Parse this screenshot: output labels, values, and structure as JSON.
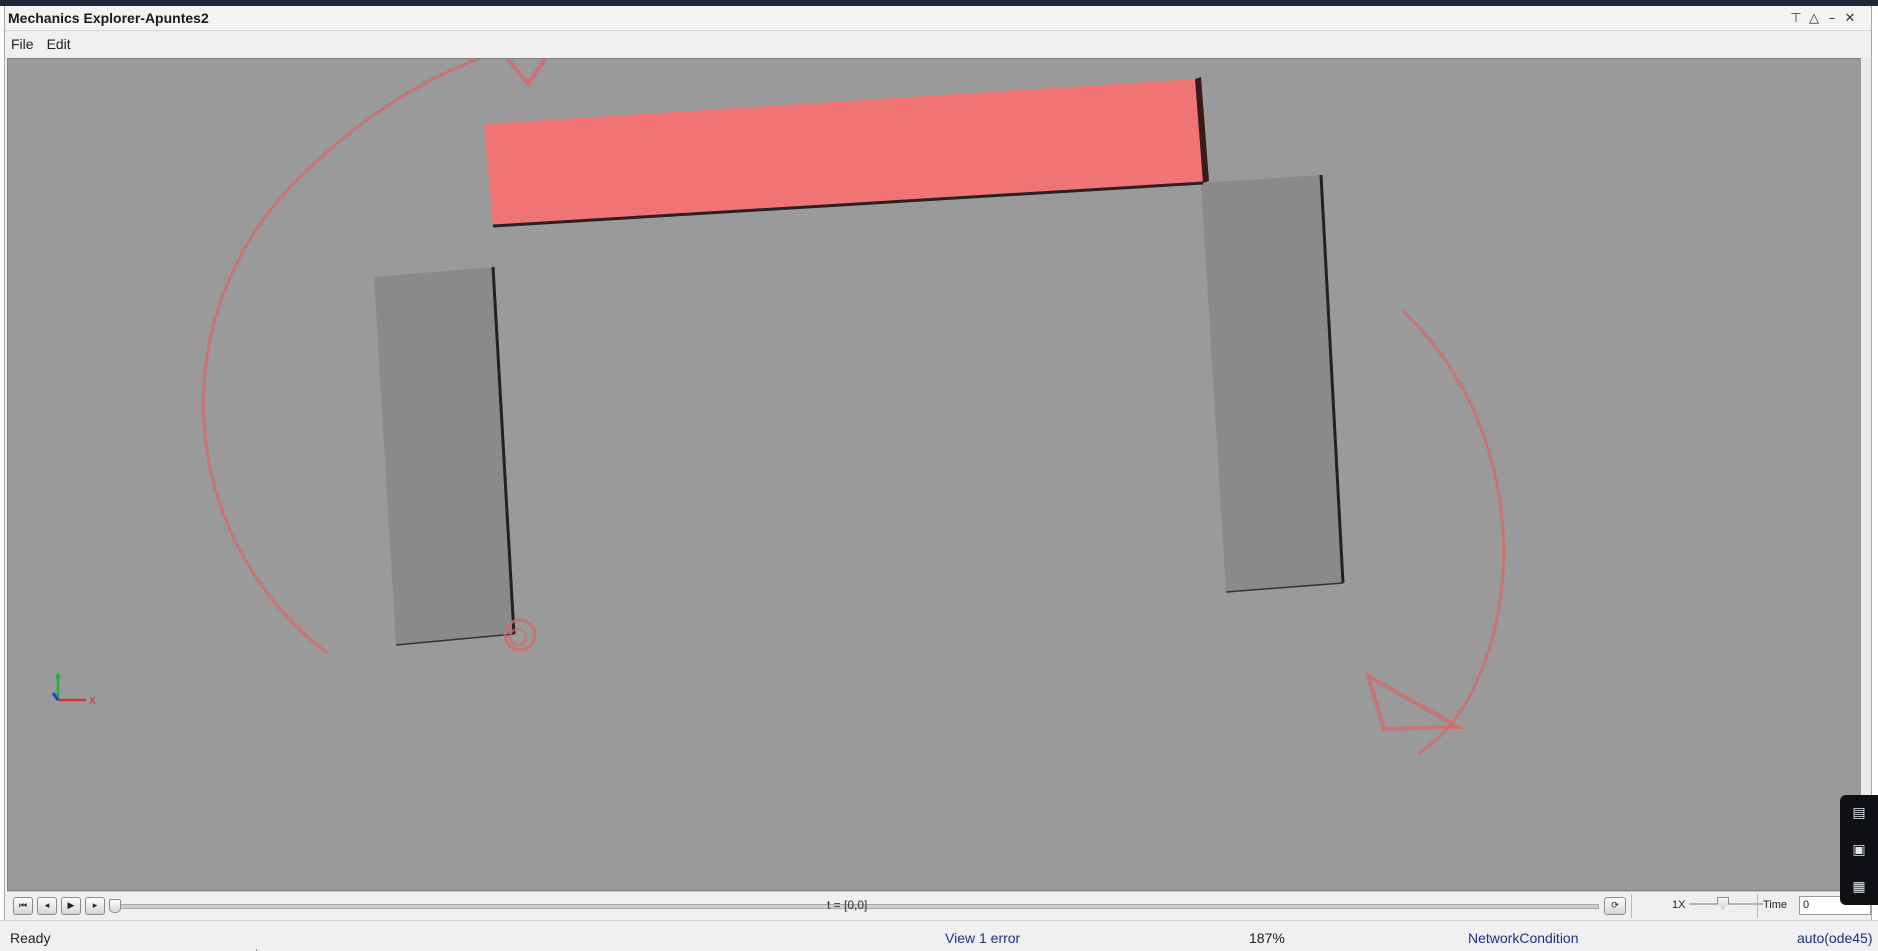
{
  "window": {
    "title": "Mechanics Explorer-Apuntes2",
    "controls": [
      "pin-icon",
      "restore-icon",
      "minimize-icon",
      "close-icon"
    ]
  },
  "menu": {
    "file": "File",
    "edit": "Edit"
  },
  "scene": {
    "background_color": "#9a9a9a",
    "highlight_color": "#f07474",
    "body_color": "#8a8a8a",
    "annotation_color": "#d46a6a",
    "triad": {
      "x_label": "X"
    }
  },
  "side_tools": {
    "icons": [
      "print-icon",
      "camera-icon",
      "layout-icon"
    ]
  },
  "playback": {
    "buttons": [
      "skip-to-start-icon",
      "step-back-icon",
      "play-icon",
      "step-forward-icon"
    ],
    "time_readout": "t = [0,0]",
    "speed": "1X",
    "time_label": "Time",
    "time_value": "0"
  },
  "status": {
    "ready": "Ready",
    "error": "View 1 error",
    "zoom": "187%",
    "network": "NetworkCondition",
    "solver": "auto(ode45)"
  }
}
